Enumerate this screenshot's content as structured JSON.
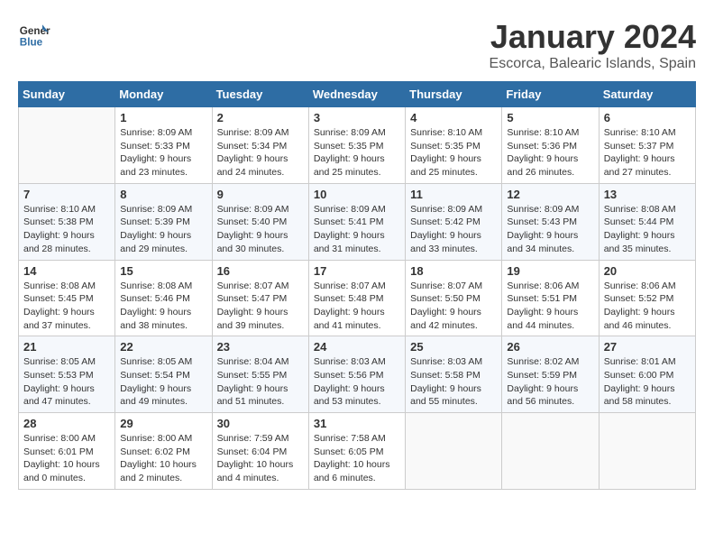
{
  "header": {
    "logo_line1": "General",
    "logo_line2": "Blue",
    "month": "January 2024",
    "location": "Escorca, Balearic Islands, Spain"
  },
  "weekdays": [
    "Sunday",
    "Monday",
    "Tuesday",
    "Wednesday",
    "Thursday",
    "Friday",
    "Saturday"
  ],
  "weeks": [
    [
      {
        "day": "",
        "info": ""
      },
      {
        "day": "1",
        "info": "Sunrise: 8:09 AM\nSunset: 5:33 PM\nDaylight: 9 hours\nand 23 minutes."
      },
      {
        "day": "2",
        "info": "Sunrise: 8:09 AM\nSunset: 5:34 PM\nDaylight: 9 hours\nand 24 minutes."
      },
      {
        "day": "3",
        "info": "Sunrise: 8:09 AM\nSunset: 5:35 PM\nDaylight: 9 hours\nand 25 minutes."
      },
      {
        "day": "4",
        "info": "Sunrise: 8:10 AM\nSunset: 5:35 PM\nDaylight: 9 hours\nand 25 minutes."
      },
      {
        "day": "5",
        "info": "Sunrise: 8:10 AM\nSunset: 5:36 PM\nDaylight: 9 hours\nand 26 minutes."
      },
      {
        "day": "6",
        "info": "Sunrise: 8:10 AM\nSunset: 5:37 PM\nDaylight: 9 hours\nand 27 minutes."
      }
    ],
    [
      {
        "day": "7",
        "info": "Sunrise: 8:10 AM\nSunset: 5:38 PM\nDaylight: 9 hours\nand 28 minutes."
      },
      {
        "day": "8",
        "info": "Sunrise: 8:09 AM\nSunset: 5:39 PM\nDaylight: 9 hours\nand 29 minutes."
      },
      {
        "day": "9",
        "info": "Sunrise: 8:09 AM\nSunset: 5:40 PM\nDaylight: 9 hours\nand 30 minutes."
      },
      {
        "day": "10",
        "info": "Sunrise: 8:09 AM\nSunset: 5:41 PM\nDaylight: 9 hours\nand 31 minutes."
      },
      {
        "day": "11",
        "info": "Sunrise: 8:09 AM\nSunset: 5:42 PM\nDaylight: 9 hours\nand 33 minutes."
      },
      {
        "day": "12",
        "info": "Sunrise: 8:09 AM\nSunset: 5:43 PM\nDaylight: 9 hours\nand 34 minutes."
      },
      {
        "day": "13",
        "info": "Sunrise: 8:08 AM\nSunset: 5:44 PM\nDaylight: 9 hours\nand 35 minutes."
      }
    ],
    [
      {
        "day": "14",
        "info": "Sunrise: 8:08 AM\nSunset: 5:45 PM\nDaylight: 9 hours\nand 37 minutes."
      },
      {
        "day": "15",
        "info": "Sunrise: 8:08 AM\nSunset: 5:46 PM\nDaylight: 9 hours\nand 38 minutes."
      },
      {
        "day": "16",
        "info": "Sunrise: 8:07 AM\nSunset: 5:47 PM\nDaylight: 9 hours\nand 39 minutes."
      },
      {
        "day": "17",
        "info": "Sunrise: 8:07 AM\nSunset: 5:48 PM\nDaylight: 9 hours\nand 41 minutes."
      },
      {
        "day": "18",
        "info": "Sunrise: 8:07 AM\nSunset: 5:50 PM\nDaylight: 9 hours\nand 42 minutes."
      },
      {
        "day": "19",
        "info": "Sunrise: 8:06 AM\nSunset: 5:51 PM\nDaylight: 9 hours\nand 44 minutes."
      },
      {
        "day": "20",
        "info": "Sunrise: 8:06 AM\nSunset: 5:52 PM\nDaylight: 9 hours\nand 46 minutes."
      }
    ],
    [
      {
        "day": "21",
        "info": "Sunrise: 8:05 AM\nSunset: 5:53 PM\nDaylight: 9 hours\nand 47 minutes."
      },
      {
        "day": "22",
        "info": "Sunrise: 8:05 AM\nSunset: 5:54 PM\nDaylight: 9 hours\nand 49 minutes."
      },
      {
        "day": "23",
        "info": "Sunrise: 8:04 AM\nSunset: 5:55 PM\nDaylight: 9 hours\nand 51 minutes."
      },
      {
        "day": "24",
        "info": "Sunrise: 8:03 AM\nSunset: 5:56 PM\nDaylight: 9 hours\nand 53 minutes."
      },
      {
        "day": "25",
        "info": "Sunrise: 8:03 AM\nSunset: 5:58 PM\nDaylight: 9 hours\nand 55 minutes."
      },
      {
        "day": "26",
        "info": "Sunrise: 8:02 AM\nSunset: 5:59 PM\nDaylight: 9 hours\nand 56 minutes."
      },
      {
        "day": "27",
        "info": "Sunrise: 8:01 AM\nSunset: 6:00 PM\nDaylight: 9 hours\nand 58 minutes."
      }
    ],
    [
      {
        "day": "28",
        "info": "Sunrise: 8:00 AM\nSunset: 6:01 PM\nDaylight: 10 hours\nand 0 minutes."
      },
      {
        "day": "29",
        "info": "Sunrise: 8:00 AM\nSunset: 6:02 PM\nDaylight: 10 hours\nand 2 minutes."
      },
      {
        "day": "30",
        "info": "Sunrise: 7:59 AM\nSunset: 6:04 PM\nDaylight: 10 hours\nand 4 minutes."
      },
      {
        "day": "31",
        "info": "Sunrise: 7:58 AM\nSunset: 6:05 PM\nDaylight: 10 hours\nand 6 minutes."
      },
      {
        "day": "",
        "info": ""
      },
      {
        "day": "",
        "info": ""
      },
      {
        "day": "",
        "info": ""
      }
    ]
  ]
}
